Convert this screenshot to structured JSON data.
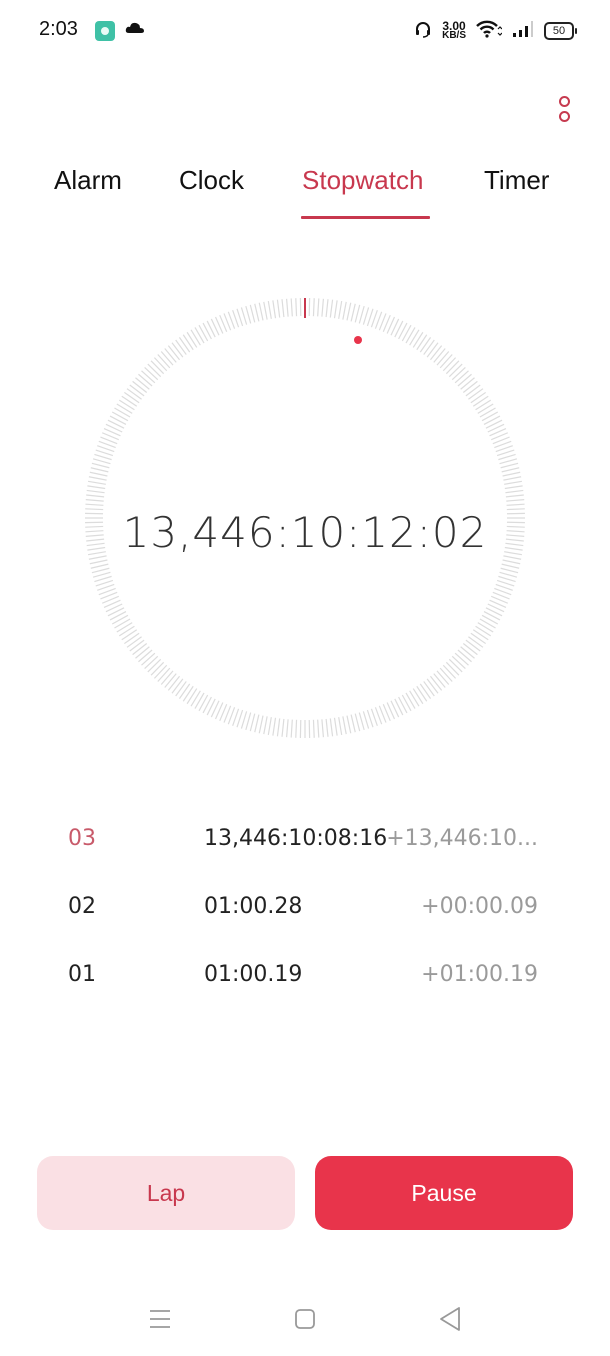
{
  "status_bar": {
    "time": "2:03",
    "app_icon": "app-notification-icon",
    "cloud_icon": "cloud-icon",
    "headset_icon": "headset-icon",
    "net_speed_value": "3.00",
    "net_speed_unit": "KB/S",
    "wifi_icon": "wifi-icon",
    "signal_icon": "signal-icon",
    "battery": "50"
  },
  "header": {
    "menu_icon": "more-vertical-icon"
  },
  "tabs": [
    {
      "label": "Alarm",
      "active": false
    },
    {
      "label": "Clock",
      "active": false
    },
    {
      "label": "Stopwatch",
      "active": true
    },
    {
      "label": "Timer",
      "active": false
    }
  ],
  "stopwatch": {
    "elapsed": "13,446:10:12:02",
    "dial_ticks": 300,
    "accent_color": "#e8344b"
  },
  "laps": [
    {
      "number": "03",
      "total": "13,446:10:08:16",
      "split": "+13,446:10...",
      "latest": true
    },
    {
      "number": "02",
      "total": "01:00.28",
      "split": "+00:00.09",
      "latest": false
    },
    {
      "number": "01",
      "total": "01:00.19",
      "split": "+01:00.19",
      "latest": false
    }
  ],
  "actions": {
    "lap_label": "Lap",
    "pause_label": "Pause"
  },
  "nav_bar": {
    "recents_icon": "menu-lines-icon",
    "home_icon": "home-square-icon",
    "back_icon": "back-triangle-icon"
  }
}
